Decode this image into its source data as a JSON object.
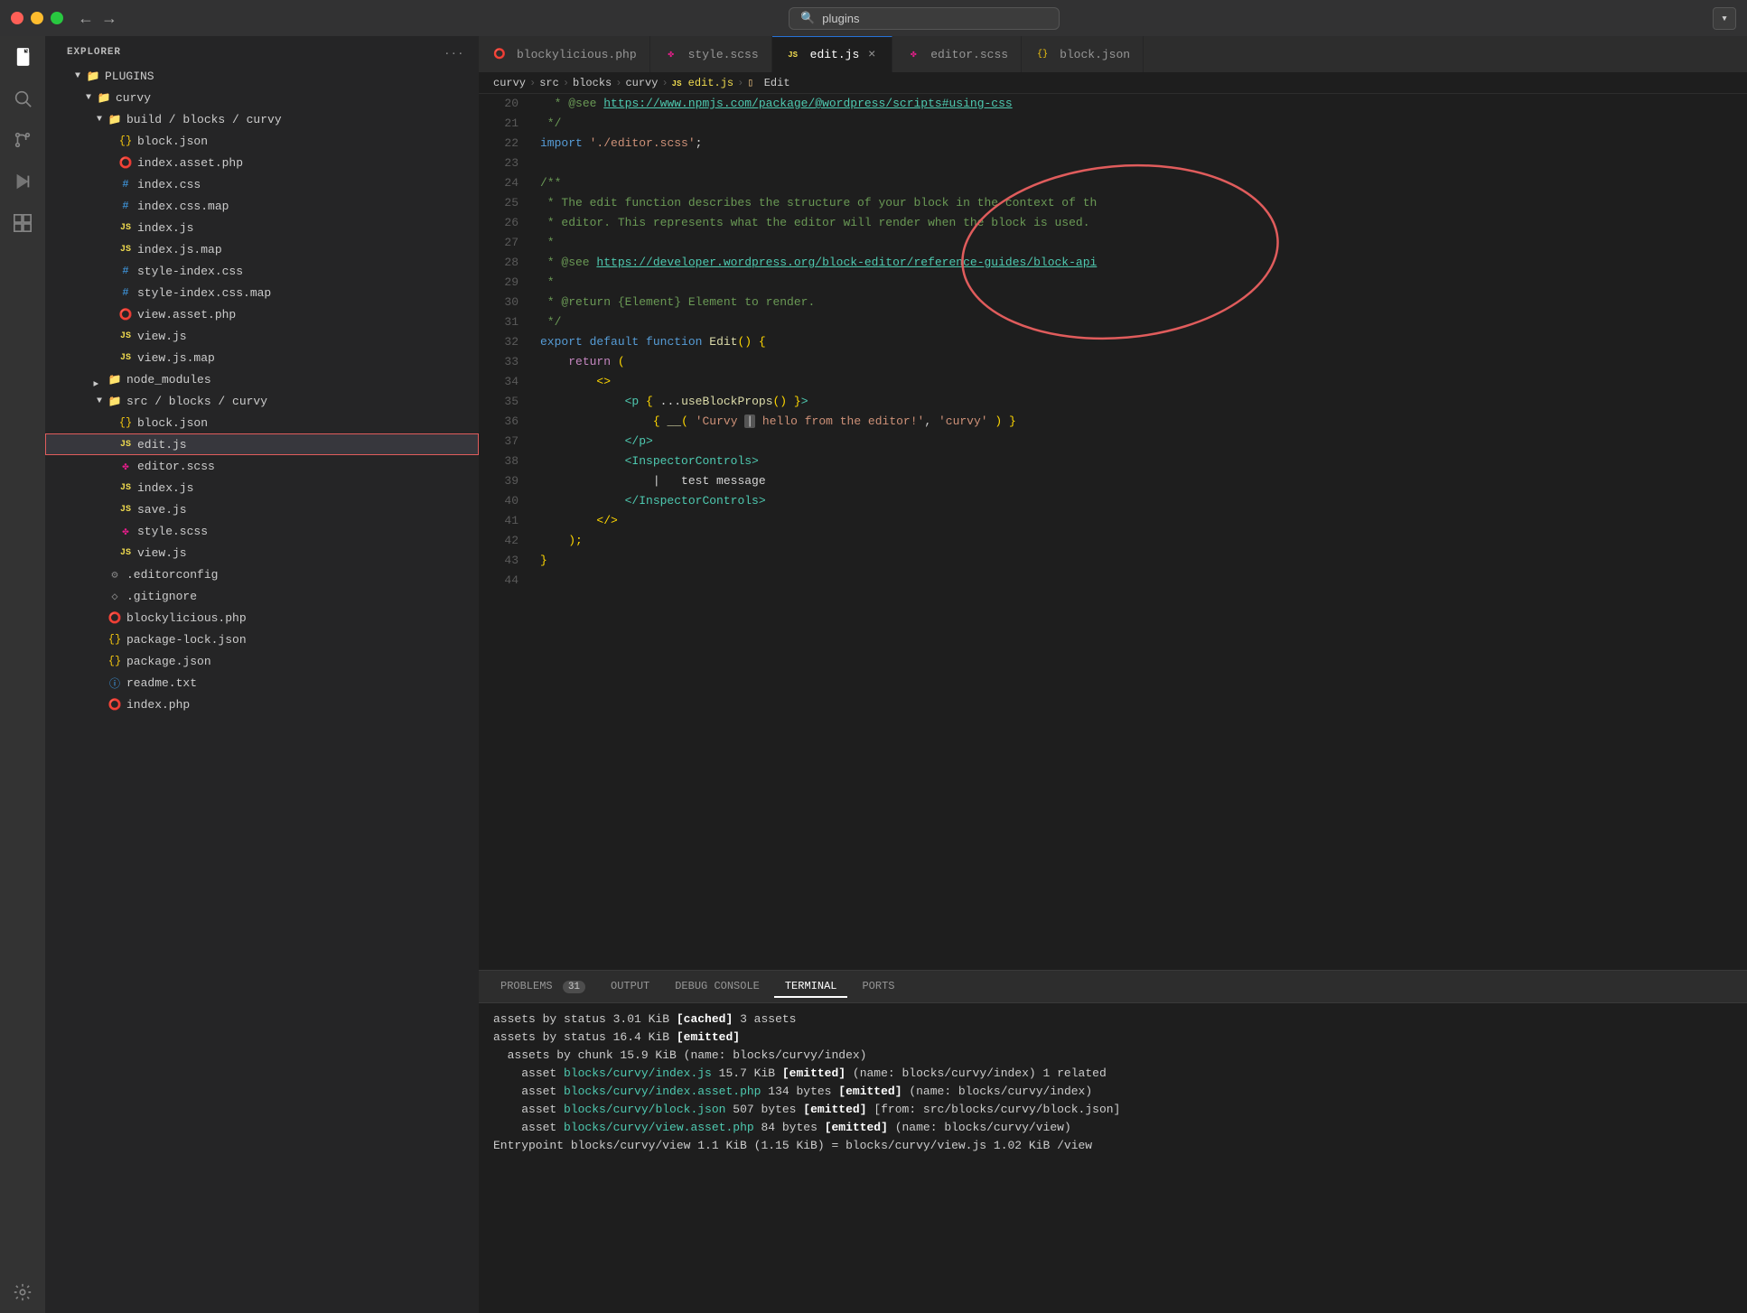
{
  "titlebar": {
    "search_placeholder": "plugins",
    "dropdown_label": "▾"
  },
  "activity_bar": {
    "icons": [
      {
        "name": "explorer-icon",
        "glyph": "⎘",
        "active": true
      },
      {
        "name": "search-icon",
        "glyph": "🔍",
        "active": false
      },
      {
        "name": "source-control-icon",
        "glyph": "⑂",
        "active": false
      },
      {
        "name": "run-icon",
        "glyph": "▷",
        "active": false
      },
      {
        "name": "extensions-icon",
        "glyph": "⊞",
        "active": false
      },
      {
        "name": "clock-icon",
        "glyph": "◷",
        "active": false
      },
      {
        "name": "chat-icon",
        "glyph": "💬",
        "active": false
      }
    ]
  },
  "sidebar": {
    "header": "Explorer",
    "more_actions": "...",
    "tree": {
      "plugins_label": "PLUGINS",
      "curvy_label": "curvy",
      "build_blocks_curvy_label": "build / blocks / curvy",
      "block_json_label": "block.json",
      "index_asset_php_label": "index.asset.php",
      "index_css_label": "index.css",
      "index_css_map_label": "index.css.map",
      "index_js_label": "index.js",
      "index_js_map_label": "index.js.map",
      "style_index_css_label": "style-index.css",
      "style_index_css_map_label": "style-index.css.map",
      "view_asset_php_label": "view.asset.php",
      "view_js_label": "view.js",
      "view_js_map_label": "view.js.map",
      "node_modules_label": "node_modules",
      "src_blocks_curvy_label": "src / blocks / curvy",
      "src_block_json_label": "block.json",
      "src_edit_js_label": "edit.js",
      "src_editor_scss_label": "editor.scss",
      "src_index_js_label": "index.js",
      "src_save_js_label": "save.js",
      "src_style_scss_label": "style.scss",
      "src_view_js_label": "view.js",
      "editorconfig_label": ".editorconfig",
      "gitignore_label": ".gitignore",
      "blockylicious_php_label": "blockylicious.php",
      "package_lock_json_label": "package-lock.json",
      "package_json_label": "package.json",
      "readme_txt_label": "readme.txt",
      "index_php_label": "index.php"
    }
  },
  "tabs": [
    {
      "id": "blockylicious-php",
      "label": "blockylicious.php",
      "icon": "php",
      "active": false,
      "closable": false
    },
    {
      "id": "style-scss",
      "label": "style.scss",
      "icon": "scss",
      "active": false,
      "closable": false
    },
    {
      "id": "edit-js",
      "label": "edit.js",
      "icon": "js",
      "active": true,
      "closable": true
    },
    {
      "id": "editor-scss",
      "label": "editor.scss",
      "icon": "scss",
      "active": false,
      "closable": false
    },
    {
      "id": "block-json",
      "label": "block.json",
      "icon": "json",
      "active": false,
      "closable": false
    }
  ],
  "breadcrumb": {
    "items": [
      "curvy",
      "src",
      "blocks",
      "curvy",
      "edit.js",
      "Edit"
    ]
  },
  "code": {
    "lines": [
      {
        "num": 20,
        "content": " * @see <https://www.npmjs.com/package/@wordpress/scripts#using-css>"
      },
      {
        "num": 21,
        "content": " */"
      },
      {
        "num": 22,
        "content": "import './editor.scss';"
      },
      {
        "num": 23,
        "content": ""
      },
      {
        "num": 24,
        "content": "/**"
      },
      {
        "num": 25,
        "content": " * The edit function describes the structure of your block in the context of th"
      },
      {
        "num": 26,
        "content": " * editor. This represents what the editor will render when the block is used."
      },
      {
        "num": 27,
        "content": " *"
      },
      {
        "num": 28,
        "content": " * @see <https://developer.wordpress.org/block-editor/reference-guides/block-api>"
      },
      {
        "num": 29,
        "content": " *"
      },
      {
        "num": 30,
        "content": " * @return {Element} Element to render."
      },
      {
        "num": 31,
        "content": " */"
      },
      {
        "num": 32,
        "content": "export default function Edit() {"
      },
      {
        "num": 33,
        "content": "    return ("
      },
      {
        "num": 34,
        "content": "        <>"
      },
      {
        "num": 35,
        "content": "            <p { ...useBlockProps() }>"
      },
      {
        "num": 36,
        "content": "                { __( 'Curvy | hello from the editor!', 'curvy' ) }"
      },
      {
        "num": 37,
        "content": "            </p>"
      },
      {
        "num": 38,
        "content": "            <InspectorControls>"
      },
      {
        "num": 39,
        "content": "                |   test message"
      },
      {
        "num": 40,
        "content": "            </InspectorControls>"
      },
      {
        "num": 41,
        "content": "        </>"
      },
      {
        "num": 42,
        "content": "    );"
      },
      {
        "num": 43,
        "content": "}"
      },
      {
        "num": 44,
        "content": ""
      }
    ]
  },
  "terminal": {
    "tabs": [
      {
        "label": "PROBLEMS",
        "badge": "31",
        "active": false
      },
      {
        "label": "OUTPUT",
        "badge": "",
        "active": false
      },
      {
        "label": "DEBUG CONSOLE",
        "badge": "",
        "active": false
      },
      {
        "label": "TERMINAL",
        "badge": "",
        "active": true
      },
      {
        "label": "PORTS",
        "badge": "",
        "active": false
      }
    ],
    "lines": [
      {
        "text": "assets by status 3.01 KiB [cached] 3 assets",
        "type": "normal"
      },
      {
        "text": "assets by status 16.4 KiB [emitted]",
        "type": "normal"
      },
      {
        "text": "  assets by chunk 15.9 KiB (name: blocks/curvy/index)",
        "type": "normal"
      },
      {
        "text": "    asset blocks/curvy/index.js 15.7 KiB [emitted] (name: blocks/curvy/index) 1 related",
        "type": "green"
      },
      {
        "text": "    asset blocks/curvy/index.asset.php 134 bytes [emitted] (name: blocks/curvy/index)",
        "type": "green"
      },
      {
        "text": "    asset blocks/curvy/block.json 507 bytes [emitted] [from: src/blocks/curvy/block.json]",
        "type": "green"
      },
      {
        "text": "    asset blocks/curvy/view.asset.php 84 bytes [emitted] (name: blocks/curvy/view)",
        "type": "green"
      },
      {
        "text": "Entrypoint blocks/curvy/view 1.1 KiB (1.15 KiB) = blocks/curvy/view.js 1.02 KiB /view",
        "type": "normal"
      }
    ]
  }
}
